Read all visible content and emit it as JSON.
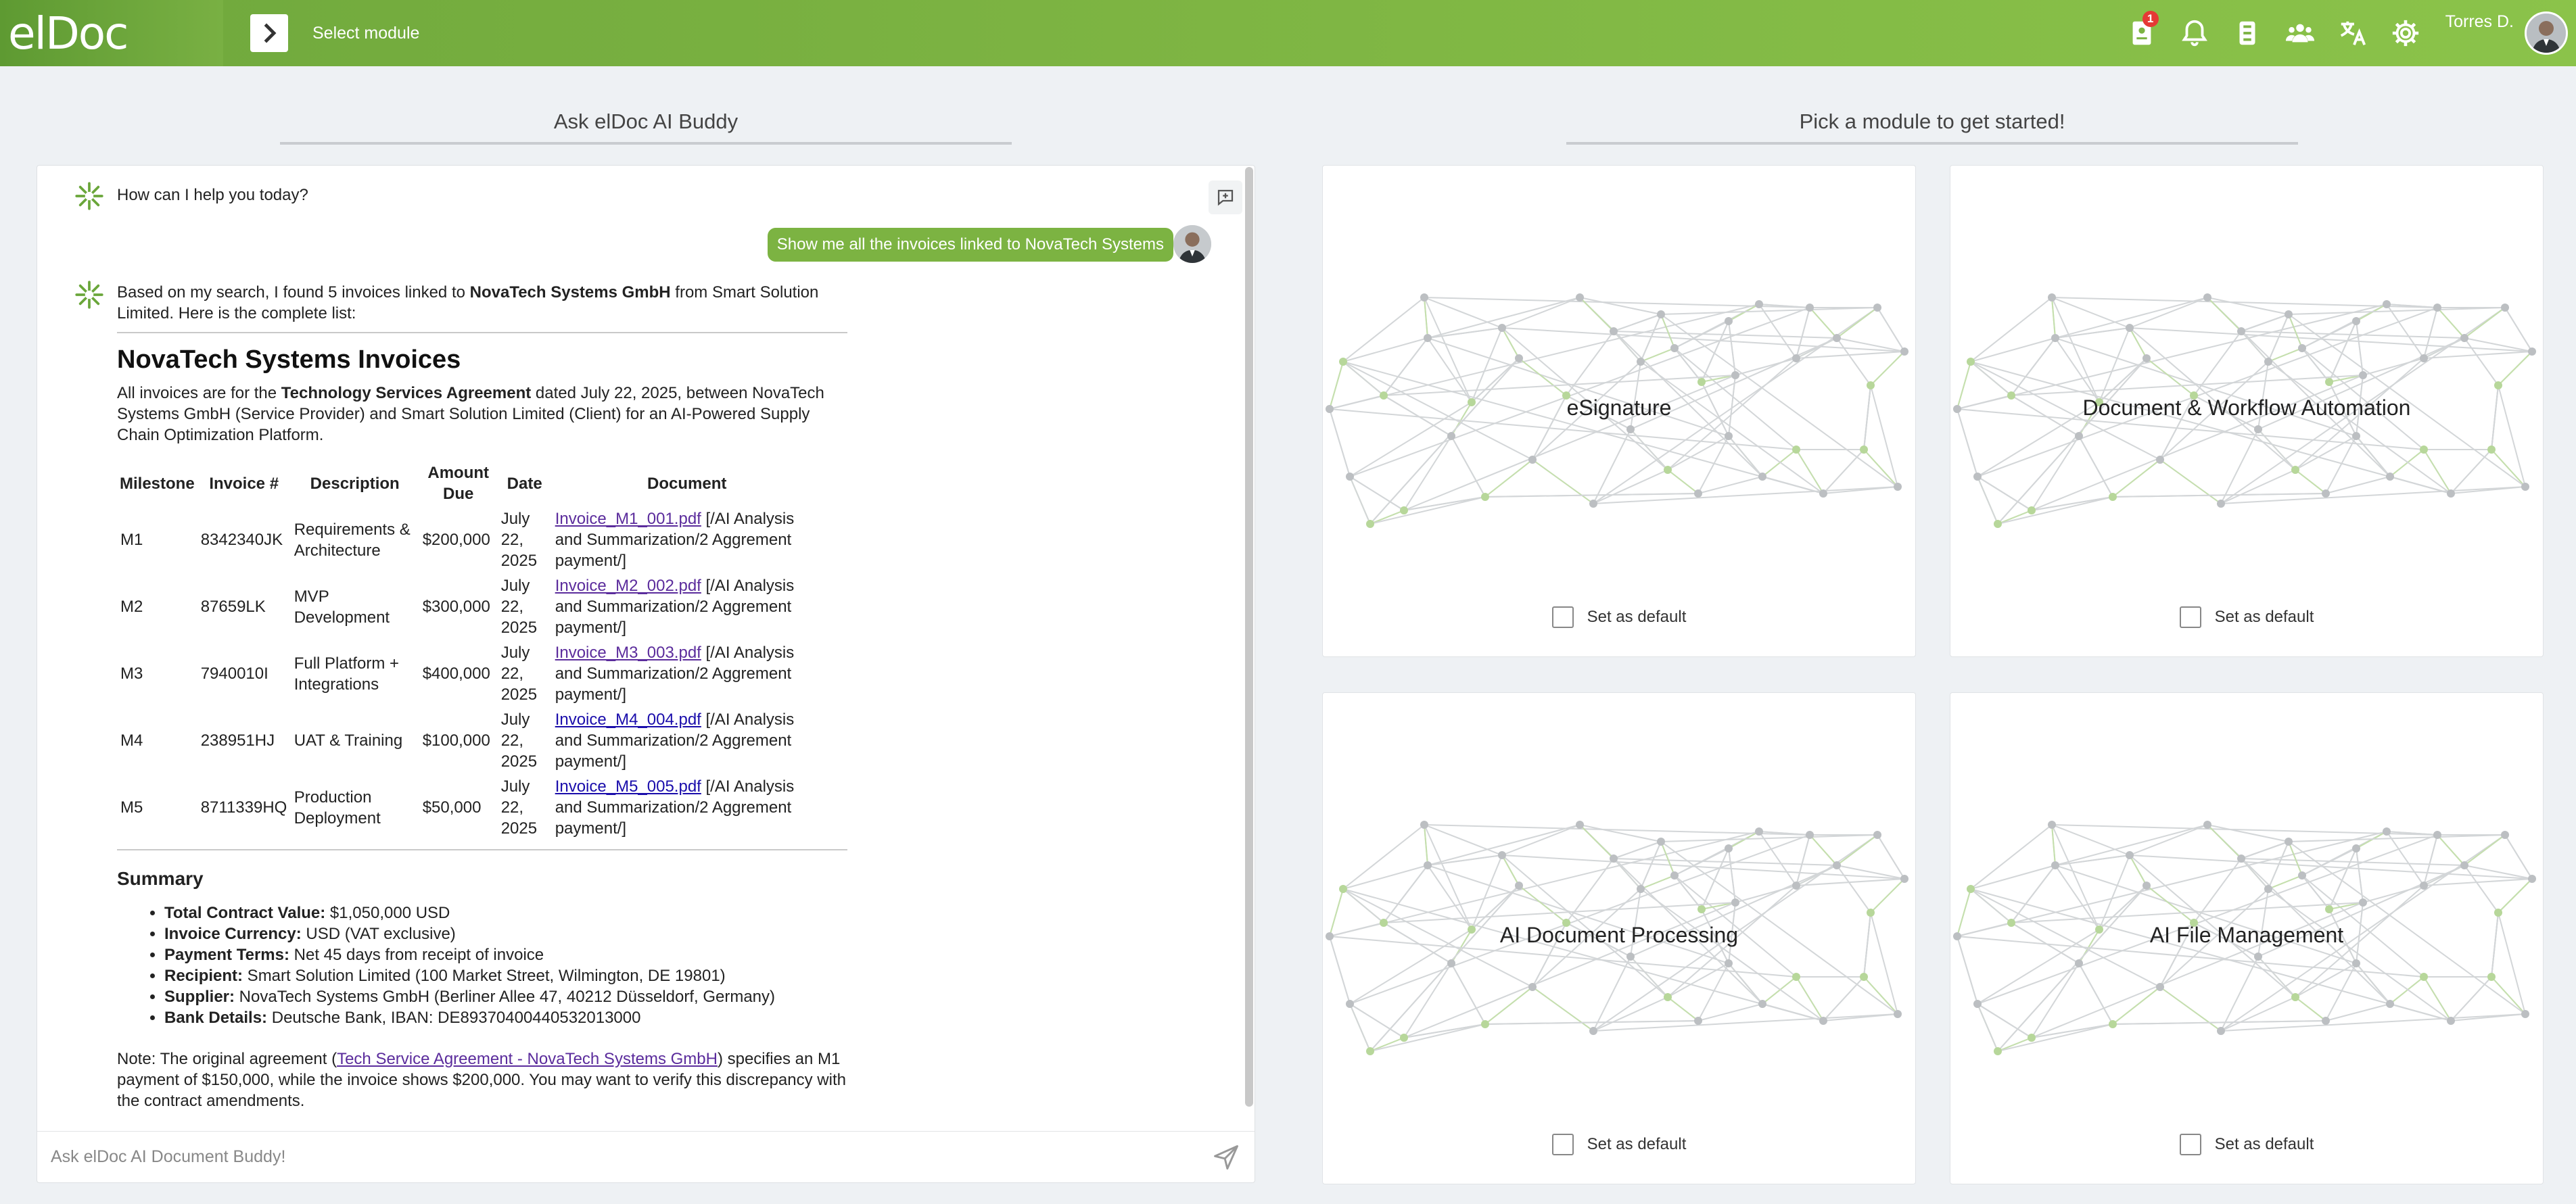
{
  "header": {
    "logo": "elDoc",
    "module_label": "Select module",
    "badge_count": "1",
    "username": "Torres D.",
    "icons": [
      "contract-icon",
      "bell-icon",
      "clipboard-icon",
      "users-icon",
      "translate-icon",
      "gear-icon"
    ],
    "accent": "#7cb342"
  },
  "left": {
    "title": "Ask elDoc AI Buddy"
  },
  "right": {
    "title": "Pick a module to get started!"
  },
  "chat": {
    "greeting": "How can I help you today?",
    "user_message": "Show me all the invoices linked to NovaTech Systems",
    "intro_pre": "Based on my search, I found 5 invoices linked to ",
    "intro_bold": "NovaTech Systems GmbH",
    "intro_post": " from Smart Solution Limited. Here is the complete list:",
    "heading": "NovaTech Systems Invoices",
    "desc_pre": "All invoices are for the ",
    "desc_bold": "Technology Services Agreement",
    "desc_post": " dated July 22, 2025, between NovaTech Systems GmbH (Service Provider) and Smart Solution Limited (Client) for an AI-Powered Supply Chain Optimization Platform.",
    "table": {
      "headers": [
        "Milestone",
        "Invoice #",
        "Description",
        "Amount Due",
        "Date",
        "Document"
      ],
      "rows": [
        {
          "milestone": "M1",
          "invoice": "8342340JK",
          "description": "Requirements & Architecture",
          "amount": "$200,000",
          "date": "July 22, 2025",
          "doc": "Invoice_M1_001.pdf",
          "path": " [/AI Analysis and Summarization/2 Aggrement payment/]"
        },
        {
          "milestone": "M2",
          "invoice": "87659LK",
          "description": "MVP Development",
          "amount": "$300,000",
          "date": "July 22, 2025",
          "doc": "Invoice_M2_002.pdf",
          "path": " [/AI Analysis and Summarization/2 Aggrement payment/]"
        },
        {
          "milestone": "M3",
          "invoice": "7940010I",
          "description": "Full Platform + Integrations",
          "amount": "$400,000",
          "date": "July 22, 2025",
          "doc": "Invoice_M3_003.pdf",
          "path": " [/AI Analysis and Summarization/2 Aggrement payment/]"
        },
        {
          "milestone": "M4",
          "invoice": "238951HJ",
          "description": "UAT & Training",
          "amount": "$100,000",
          "date": "July 22, 2025",
          "doc": "Invoice_M4_004.pdf",
          "path": " [/AI Analysis and Summarization/2 Aggrement payment/]"
        },
        {
          "milestone": "M5",
          "invoice": "8711339HQ",
          "description": "Production Deployment",
          "amount": "$50,000",
          "date": "July 22, 2025",
          "doc": "Invoice_M5_005.pdf",
          "path": " [/AI Analysis and Summarization/2 Aggrement payment/]"
        }
      ]
    },
    "summary_heading": "Summary",
    "summary": [
      {
        "label": "Total Contract Value:",
        "value": " $1,050,000 USD"
      },
      {
        "label": "Invoice Currency:",
        "value": " USD (VAT exclusive)"
      },
      {
        "label": "Payment Terms:",
        "value": " Net 45 days from receipt of invoice"
      },
      {
        "label": "Recipient:",
        "value": " Smart Solution Limited (100 Market Street, Wilmington, DE 19801)"
      },
      {
        "label": "Supplier:",
        "value": " NovaTech Systems GmbH (Berliner Allee 47, 40212 Düsseldorf, Germany)"
      },
      {
        "label": "Bank Details:",
        "value": " Deutsche Bank, IBAN: DE89370400440532013000"
      }
    ],
    "note_pre": "Note: The original agreement (",
    "note_link": "Tech Service Agreement - NovaTech Systems GmbH",
    "note_post": ") specifies an M1 payment of $150,000, while the invoice shows $200,000. You may want to verify this discrepancy with the contract amendments.",
    "input_placeholder": "Ask elDoc AI Document Buddy!"
  },
  "modules": [
    {
      "title": "eSignature",
      "default_label": "Set as default"
    },
    {
      "title": "Document & Workflow Automation",
      "default_label": "Set as default"
    },
    {
      "title": "AI Document Processing",
      "default_label": "Set as default"
    },
    {
      "title": "AI File Management",
      "default_label": "Set as default"
    }
  ]
}
